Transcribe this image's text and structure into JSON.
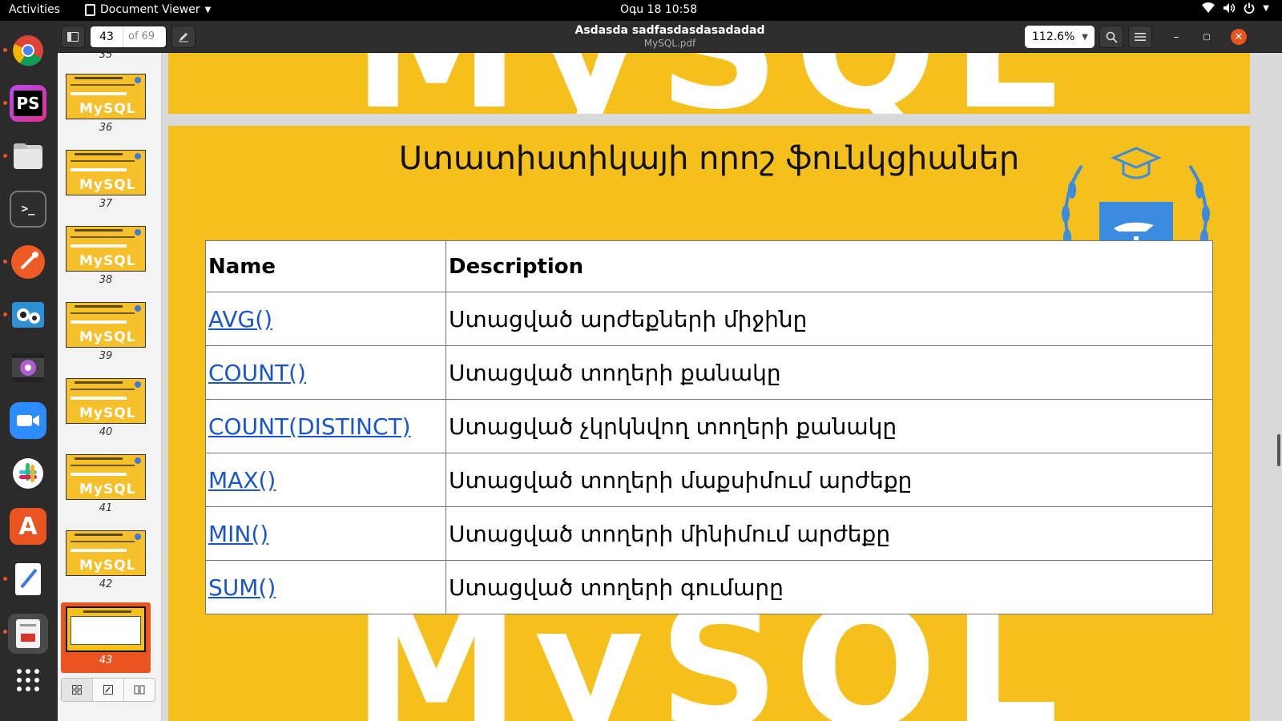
{
  "topbar": {
    "activities": "Activities",
    "app_name": "Document Viewer",
    "clock": "Օգս 18  10:58"
  },
  "dock": {
    "items": [
      {
        "name": "chrome-icon"
      },
      {
        "name": "phpstorm-icon",
        "label": "PS"
      },
      {
        "name": "files-icon"
      },
      {
        "name": "terminal-icon",
        "label": ">_"
      },
      {
        "name": "postman-icon"
      },
      {
        "name": "screenshot-icon"
      },
      {
        "name": "video-icon"
      },
      {
        "name": "zoom-icon"
      },
      {
        "name": "slack-icon"
      },
      {
        "name": "software-icon",
        "label": "A"
      },
      {
        "name": "text-editor-icon"
      },
      {
        "name": "document-viewer-icon"
      },
      {
        "name": "app-grid-icon"
      }
    ]
  },
  "header": {
    "page_value": "43",
    "page_of": "of 69",
    "title": "Asdasda sadfasdasdasadadad",
    "subtitle": "MySQL.pdf",
    "zoom": "112.6%"
  },
  "sidebar": {
    "thumbs": [
      {
        "num": "36"
      },
      {
        "num": "37"
      },
      {
        "num": "38"
      },
      {
        "num": "39"
      },
      {
        "num": "40"
      },
      {
        "num": "41"
      },
      {
        "num": "42"
      },
      {
        "num": "43"
      }
    ],
    "partial_num": "35"
  },
  "slide": {
    "title": "Ստատիստիկայի որոշ ֆունկցիաներ",
    "watermark": "MySQL",
    "table": {
      "headers": [
        "Name",
        "Description"
      ],
      "rows": [
        {
          "name": "AVG()",
          "desc": "Ստացված արժեքների միջինը"
        },
        {
          "name": "COUNT()",
          "desc": "Ստացված  տողերի քանակը"
        },
        {
          "name": "COUNT(DISTINCT)",
          "desc": "Ստացված  չկրկնվող տողերի քանակը"
        },
        {
          "name": "MAX()",
          "desc": "Ստացված  տողերի  մաքսիմում արժեքը"
        },
        {
          "name": "MIN()",
          "desc": "Ստացված  տողերի  մինիմում արժեքը"
        },
        {
          "name": "SUM()",
          "desc": "Ստացված  տողերի գումարը"
        }
      ]
    }
  },
  "colors": {
    "slide_bg": "#f5bf1c",
    "link": "#1a55c9",
    "accent": "#e95420"
  }
}
